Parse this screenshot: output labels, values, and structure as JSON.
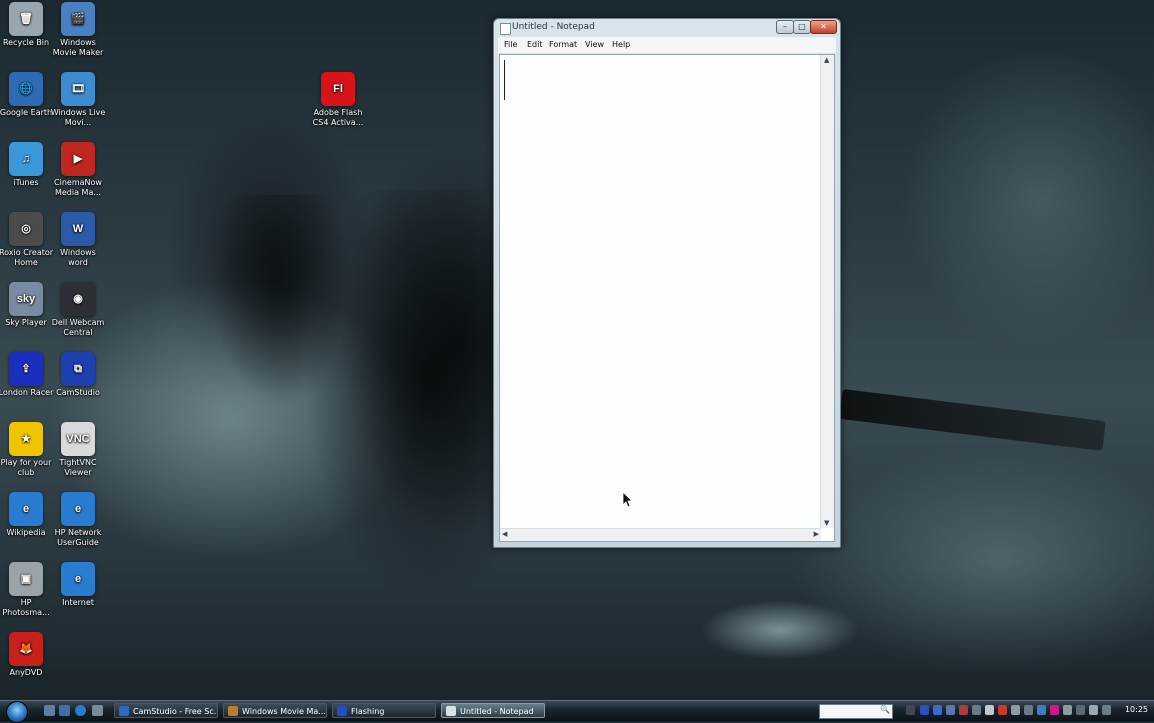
{
  "desktop": {
    "icons": [
      {
        "label": "Recycle Bin",
        "glyph": "🗑",
        "color": "#9aa6ad"
      },
      {
        "label": "Windows Movie Maker",
        "glyph": "🎬",
        "color": "#4a7fc0"
      },
      {
        "label": "Google Earth",
        "glyph": "🌐",
        "color": "#2d6cb5"
      },
      {
        "label": "Windows Live Movi...",
        "glyph": "🎞",
        "color": "#3d8bd0"
      },
      {
        "label": "iTunes",
        "glyph": "♫",
        "color": "#3a97d8"
      },
      {
        "label": "CinemaNow Media Ma...",
        "glyph": "▶",
        "color": "#c0271e"
      },
      {
        "label": "Roxio Creator Home",
        "glyph": "◎",
        "color": "#4b4b4b"
      },
      {
        "label": "Windows word",
        "glyph": "W",
        "color": "#2b5aa8"
      },
      {
        "label": "Sky Player",
        "glyph": "sky",
        "color": "#7a8aa0"
      },
      {
        "label": "Dell Webcam Central",
        "glyph": "◉",
        "color": "#2c2f33"
      },
      {
        "label": "London Racer",
        "glyph": "⇪",
        "color": "#1c2ec0"
      },
      {
        "label": "CamStudio",
        "glyph": "⧉",
        "color": "#1d3fb0"
      },
      {
        "label": "Play for your club",
        "glyph": "★",
        "color": "#f0c400"
      },
      {
        "label": "TightVNC Viewer",
        "glyph": "VNC",
        "color": "#d9d9d9"
      },
      {
        "label": "Wikipedia",
        "glyph": "e",
        "color": "#2a7cd0"
      },
      {
        "label": "HP Network UserGuide",
        "glyph": "e",
        "color": "#2a7cd0"
      },
      {
        "label": "HP Photosma...",
        "glyph": "▣",
        "color": "#9aa3a8"
      },
      {
        "label": "Internet",
        "glyph": "e",
        "color": "#2a7cd0"
      },
      {
        "label": "AnyDVD",
        "glyph": "🦊",
        "color": "#c8201a"
      },
      {
        "label": "Adobe Flash CS4 Activa...",
        "glyph": "Fl",
        "color": "#d8141a"
      }
    ]
  },
  "notepad": {
    "title": "Untitled - Notepad",
    "menu": [
      "File",
      "Edit",
      "Format",
      "View",
      "Help"
    ],
    "content": "",
    "buttons": {
      "minimize": "–",
      "maximize": "□",
      "close": "✕"
    }
  },
  "taskbar": {
    "buttons": [
      {
        "label": "CamStudio - Free Sc...",
        "color": "#2a6bc8",
        "active": false
      },
      {
        "label": "Windows Movie Ma...",
        "color": "#c07a2a",
        "active": false
      },
      {
        "label": "Flashing",
        "color": "#2a4bc8",
        "active": false
      },
      {
        "label": "Untitled - Notepad",
        "color": "#d8e4ea",
        "active": true
      }
    ],
    "search_icon": "🔍",
    "clock": "10:25"
  }
}
